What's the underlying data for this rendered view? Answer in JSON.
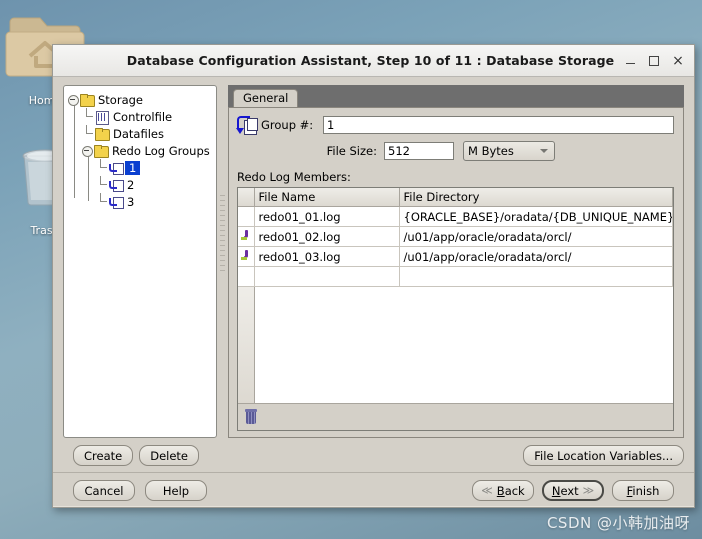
{
  "desktop": {
    "icons": [
      {
        "name": "home-folder",
        "label": "Home"
      },
      {
        "name": "trash",
        "label": "Trash"
      }
    ],
    "watermark": "CSDN @小韩加油呀"
  },
  "window": {
    "title": "Database Configuration Assistant, Step 10 of 11 : Database Storage",
    "controls": {
      "minimize": "–",
      "maximize": "□",
      "close": "×"
    }
  },
  "tree": {
    "nodes": [
      {
        "label": "Storage",
        "icon": "folder-icon",
        "level": 1,
        "expanded": true,
        "selected": false
      },
      {
        "label": "Controlfile",
        "icon": "controlfile-icon",
        "level": 2,
        "expanded": false,
        "selected": false
      },
      {
        "label": "Datafiles",
        "icon": "folder-icon",
        "level": 2,
        "expanded": false,
        "selected": false
      },
      {
        "label": "Redo Log Groups",
        "icon": "folder-icon",
        "level": 2,
        "expanded": true,
        "selected": false
      },
      {
        "label": "1",
        "icon": "redo-log-icon",
        "level": 3,
        "expanded": false,
        "selected": true
      },
      {
        "label": "2",
        "icon": "redo-log-icon",
        "level": 3,
        "expanded": false,
        "selected": false
      },
      {
        "label": "3",
        "icon": "redo-log-icon",
        "level": 3,
        "expanded": false,
        "selected": false
      }
    ]
  },
  "tabs": {
    "items": [
      {
        "label": "General",
        "active": true
      }
    ]
  },
  "form": {
    "group_label": "Group #:",
    "group_value": "1",
    "filesize_label": "File Size:",
    "filesize_value": "512",
    "filesize_unit": "M Bytes",
    "members_label": "Redo Log Members:"
  },
  "table": {
    "columns": [
      "",
      "File Name",
      "File Directory"
    ],
    "rows": [
      {
        "marker": false,
        "file_name": "redo01_01.log",
        "file_directory": "{ORACLE_BASE}/oradata/{DB_UNIQUE_NAME}/"
      },
      {
        "marker": true,
        "file_name": "redo01_02.log",
        "file_directory": "/u01/app/oracle/oradata/orcl/"
      },
      {
        "marker": true,
        "file_name": "redo01_03.log",
        "file_directory": "/u01/app/oracle/oradata/orcl/"
      },
      {
        "marker": false,
        "file_name": "",
        "file_directory": ""
      }
    ],
    "footer_icon": "trash-icon"
  },
  "actions": {
    "create": "Create",
    "delete": "Delete",
    "file_location_variables": "File Location Variables..."
  },
  "navigation": {
    "cancel": "Cancel",
    "help": "Help",
    "back": "Back",
    "back_mnemonic": "B",
    "next": "Next",
    "next_mnemonic": "N",
    "finish": "Finish",
    "finish_mnemonic": "F",
    "back_arrow": "≪",
    "next_arrow": "≫"
  },
  "colors": {
    "window_bg": "#d4d0c8",
    "selection": "#0a3fd0",
    "tabstrip": "#6e6e6e",
    "desktop_top": "#6e93ad"
  }
}
